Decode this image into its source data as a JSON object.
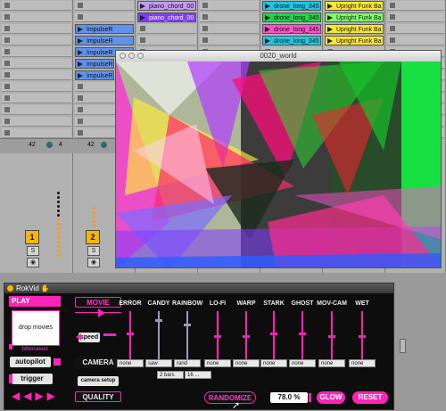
{
  "session": {
    "clips": {
      "impulse_label": "ImpulseR",
      "piano": "piano_chord_00",
      "piano2": "piano_chord_00",
      "drone": "drone_long_345",
      "upright": "Upright Funk Ba"
    },
    "mixer": {
      "track_a_value": "42",
      "track_a_num": "4",
      "track_b_value": "42",
      "track_b_num": "4",
      "track1": "1",
      "track2": "2",
      "solo": "S"
    },
    "meter_value": "60"
  },
  "video_window": {
    "title": "0020_world"
  },
  "device": {
    "title": "RokVid",
    "play": "PLAY",
    "drop_movies": "drop movies",
    "film_name": "bittersweet",
    "autopilot": "autopilot",
    "trigger": "trigger",
    "movie": "MOVIE",
    "speed": "speed",
    "camera": "CAMERA",
    "camera_setup": "camera setup",
    "quality": "QUALITY",
    "effects": [
      "ERROR",
      "CANDY",
      "RAINBOW",
      "LO-FI",
      "WARP",
      "STARK",
      "GHOST",
      "MOV-CAM",
      "WET"
    ],
    "selects": [
      "none",
      "saw",
      "rand",
      "none",
      "none",
      "none",
      "none",
      "none",
      "none"
    ],
    "selects2": [
      "2 bars",
      "16 ..."
    ],
    "randomize": "RANDOMIZE",
    "percent": "78.0 %",
    "glow": "GLOW",
    "reset": "RESET"
  },
  "colors": {
    "accent": "#ff23b9",
    "background": "#0d0d0d"
  }
}
